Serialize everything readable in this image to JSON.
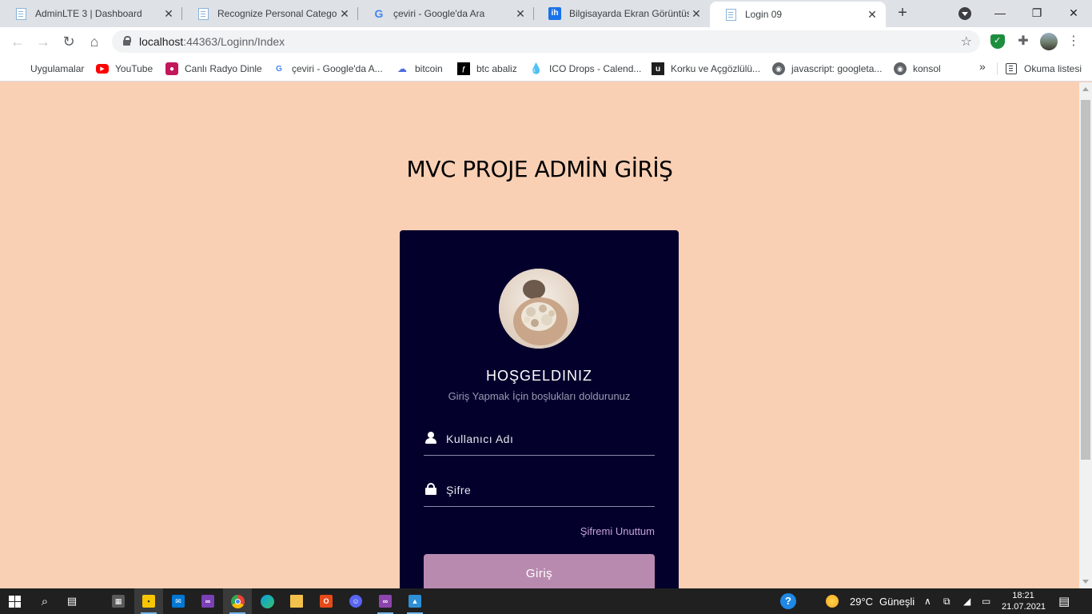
{
  "browser": {
    "tabs": [
      {
        "title": "AdminLTE 3 | Dashboard",
        "favicon": "document-icon",
        "active": false
      },
      {
        "title": "Recognize Personal Category",
        "favicon": "document-icon",
        "active": false
      },
      {
        "title": "çeviri - Google'da Ara",
        "favicon": "google-icon",
        "active": false
      },
      {
        "title": "Bilgisayarda Ekran Görüntüsü",
        "favicon": "ih-icon",
        "active": false
      },
      {
        "title": "Login 09",
        "favicon": "document-icon",
        "active": true
      }
    ],
    "new_tab_label": "+",
    "address": {
      "host": "localhost",
      "rest": ":44363/Loginn/Index"
    },
    "bookmarks": [
      {
        "label": "Uygulamalar",
        "icon": "apps-icon"
      },
      {
        "label": "YouTube",
        "icon": "youtube-icon"
      },
      {
        "label": "Canlı Radyo Dinle",
        "icon": "radio-icon"
      },
      {
        "label": "çeviri - Google'da A...",
        "icon": "google-icon"
      },
      {
        "label": "bitcoin",
        "icon": "bitcoin-icon"
      },
      {
        "label": "btc abaliz",
        "icon": "btc-icon"
      },
      {
        "label": "ICO Drops - Calend...",
        "icon": "drop-icon"
      },
      {
        "label": "Korku ve Açgözlülü...",
        "icon": "u-icon"
      },
      {
        "label": "javascript: googleta...",
        "icon": "globe-icon"
      },
      {
        "label": "konsol",
        "icon": "globe-icon"
      }
    ],
    "more_bookmarks": "»",
    "reading_list": "Okuma listesi"
  },
  "page": {
    "title": "MVC PROJE ADMİN GİRİŞ",
    "card": {
      "heading": "HOŞGELDINIZ",
      "subheading": "Giriş Yapmak İçin boşlukları doldurunuz",
      "username_placeholder": "Kullanıcı Adı",
      "password_placeholder": "Şifre",
      "forgot_link": "Şifremi Unuttum",
      "submit_label": "Giriş"
    },
    "colors": {
      "background": "#f9d0b4",
      "card": "#03012c",
      "button": "#b98ab0",
      "link": "#c7a0d8"
    }
  },
  "taskbar": {
    "weather": {
      "temperature": "29°C",
      "condition": "Güneşli"
    },
    "clock": {
      "time": "18:21",
      "date": "21.07.2021"
    }
  }
}
